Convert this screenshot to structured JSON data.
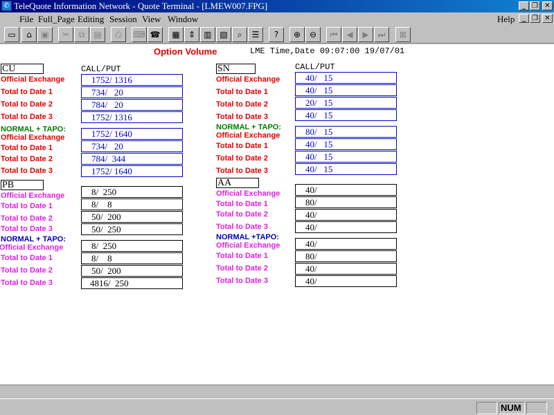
{
  "window": {
    "title": "TeleQuote Information Network - Quote Terminal - [LMEW007.FPG]"
  },
  "menu": {
    "items": [
      "File",
      "Full_Page",
      "Editing",
      "Session",
      "View",
      "Window"
    ],
    "help": "Help"
  },
  "page": {
    "title": "Option Volume",
    "time_label": "LME Time,Date",
    "time": "09:07:00",
    "date": "19/07/01"
  },
  "column_header": "CALL/PUT",
  "labels": {
    "official": "Official Exchange",
    "ttd1": "Total to Date 1",
    "ttd2": "Total to Date 2",
    "ttd3": "Total to Date 3",
    "normal_tapo": "NORMAL + TAPO:",
    "normal_tapo_alt": "NORMAL +TAPO:"
  },
  "metals": {
    "cu": {
      "name": "CU",
      "main": [
        "1752/ 1316",
        "734/   20",
        "784/   20",
        "1752/ 1316"
      ],
      "tapo": [
        "1752/ 1640",
        "734/   20",
        "784/  344",
        "1752/ 1640"
      ]
    },
    "sn": {
      "name": "SN",
      "main": [
        "40/   15",
        "40/   15",
        "20/   15",
        "40/   15"
      ],
      "tapo": [
        "80/   15",
        "40/   15",
        "40/   15",
        "40/   15"
      ]
    },
    "pb": {
      "name": "PB",
      "main": [
        "8/  250",
        "8/    8",
        "50/  200",
        "50/  250"
      ],
      "tapo": [
        "8/  250",
        "8/    8",
        "50/  200",
        "4816/  250"
      ]
    },
    "aa": {
      "name": "AA",
      "main": [
        "40/",
        "80/",
        "40/",
        "40/"
      ],
      "tapo": [
        "40/",
        "80/",
        "40/",
        "40/"
      ]
    }
  },
  "status": {
    "num": "NUM"
  }
}
